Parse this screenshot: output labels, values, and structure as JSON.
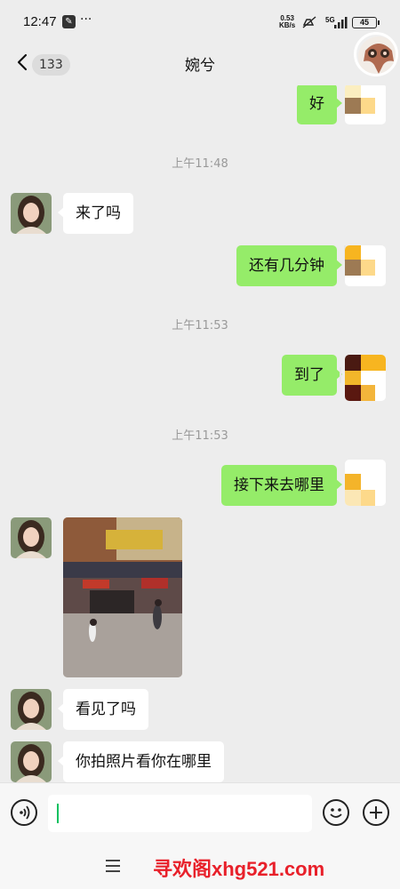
{
  "status_bar": {
    "time": "12:47",
    "more": "···",
    "net_speed": "0.53",
    "net_unit": "KB/s",
    "signal_type": "5G",
    "battery": "45"
  },
  "header": {
    "unread_count": "133",
    "title": "婉兮"
  },
  "messages": [
    {
      "type": "text",
      "side": "out",
      "text": "好"
    },
    {
      "type": "time",
      "text": "上午11:48"
    },
    {
      "type": "text",
      "side": "in",
      "text": "来了吗"
    },
    {
      "type": "text",
      "side": "out",
      "text": "还有几分钟"
    },
    {
      "type": "time",
      "text": "上午11:53"
    },
    {
      "type": "text",
      "side": "out",
      "text": "到了"
    },
    {
      "type": "time",
      "text": "上午11:53"
    },
    {
      "type": "text",
      "side": "out",
      "text": "接下来去哪里"
    },
    {
      "type": "image",
      "side": "in"
    },
    {
      "type": "text",
      "side": "in",
      "text": "看见了吗"
    },
    {
      "type": "text",
      "side": "in",
      "text": "你拍照片看你在哪里"
    }
  ],
  "input": {
    "value": ""
  },
  "watermark": "寻欢阁xhg521.com",
  "colors": {
    "outgoing_bubble": "#95ec69",
    "incoming_bubble": "#ffffff",
    "background": "#ededed",
    "caret": "#07c160",
    "watermark": "#e8202a"
  },
  "icons": [
    "back-chevron-icon",
    "voice-icon",
    "emoji-icon",
    "plus-icon",
    "menu-icon"
  ]
}
